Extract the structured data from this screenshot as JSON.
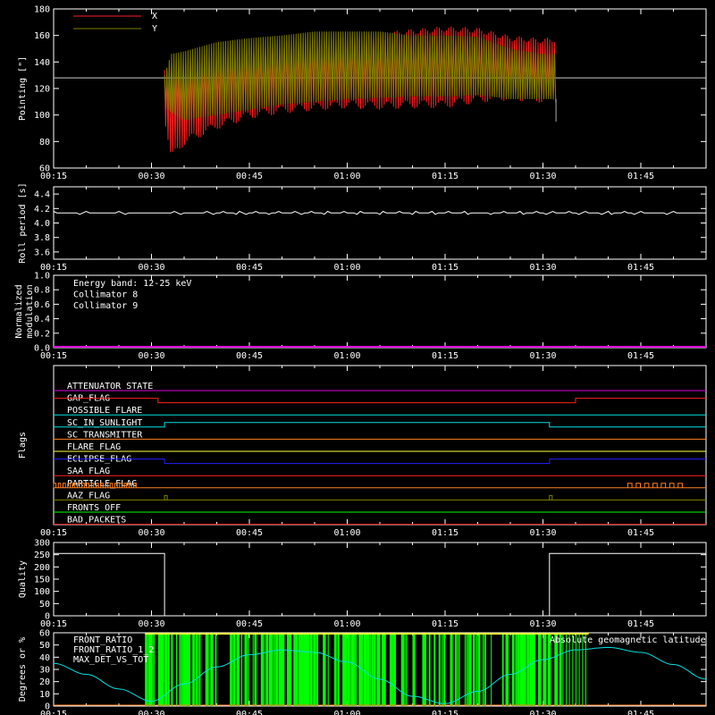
{
  "colors": {
    "background": "#000000",
    "axes": "#ffffff",
    "x_series": "#ff2020",
    "y_series": "#808000",
    "cyan": "#00e0e0",
    "magenta": "#e000e0",
    "green": "#00ff00",
    "yellow": "#ffff40",
    "orange": "#ff8020"
  },
  "time_axis": {
    "start": "00:15",
    "end": "01:55",
    "tick_labels": [
      "00:15",
      "00:30",
      "00:45",
      "01:00",
      "01:15",
      "01:30",
      "01:45"
    ]
  },
  "chart_data": [
    {
      "id": "pointing",
      "type": "line",
      "ylabel": "Pointing [\"]",
      "ylim": [
        60,
        180
      ],
      "yticks": [
        60,
        80,
        100,
        120,
        140,
        160,
        180
      ],
      "reference_line": 128,
      "legend": [
        {
          "name": "X",
          "color": "#ff2020"
        },
        {
          "name": "Y",
          "color": "#808000"
        }
      ],
      "data_start": "00:32",
      "data_end": "01:32",
      "series": [
        {
          "name": "X",
          "time": [
            "00:32",
            "00:33",
            "00:35",
            "00:40",
            "00:45",
            "00:50",
            "00:55",
            "01:00",
            "01:05",
            "01:10",
            "01:15",
            "01:20",
            "01:25",
            "01:30",
            "01:32"
          ],
          "upper": [
            132,
            136,
            140,
            146,
            150,
            153,
            155,
            157,
            160,
            163,
            165,
            164,
            158,
            156,
            157
          ],
          "lower": [
            100,
            68,
            80,
            92,
            100,
            104,
            106,
            108,
            107,
            108,
            108,
            112,
            114,
            112,
            112
          ]
        },
        {
          "name": "Y",
          "time": [
            "00:32",
            "00:33",
            "00:35",
            "00:40",
            "00:45",
            "00:50",
            "00:55",
            "01:00",
            "01:05",
            "01:10",
            "01:15",
            "01:20",
            "01:25",
            "01:30",
            "01:32"
          ],
          "upper": [
            130,
            146,
            148,
            155,
            158,
            160,
            163,
            163,
            163,
            160,
            160,
            159,
            150,
            146,
            146
          ],
          "lower": [
            106,
            102,
            96,
            100,
            104,
            108,
            110,
            112,
            113,
            114,
            114,
            115,
            112,
            112,
            112
          ]
        }
      ]
    },
    {
      "id": "roll",
      "type": "line",
      "ylabel": "Roll period [s]",
      "ylim": [
        3.5,
        4.5
      ],
      "yticks": [
        3.6,
        3.8,
        4.0,
        4.2,
        4.4
      ],
      "series": [
        {
          "name": "",
          "time": [
            "00:15",
            "01:55"
          ],
          "values": [
            4.14,
            4.14
          ]
        }
      ]
    },
    {
      "id": "modulation",
      "type": "line",
      "ylabel": "Normalized modulation",
      "ylim": [
        0,
        1
      ],
      "yticks": [
        0.0,
        0.2,
        0.4,
        0.6,
        0.8,
        1.0
      ],
      "annotations": [
        {
          "text": "Energy band: 12-25 keV",
          "color": "#ffffff"
        },
        {
          "text": "Collimator 8",
          "color": "#00e0e0"
        },
        {
          "text": "Collimator 9",
          "color": "#e000e0"
        }
      ],
      "series": [
        {
          "name": "Collimator 9",
          "time": [
            "00:15",
            "01:55"
          ],
          "values": [
            0.0,
            0.0
          ]
        }
      ]
    },
    {
      "id": "flags",
      "type": "line",
      "ylabel": "Flags",
      "rows": [
        {
          "name": "ATTENUATOR_STATE",
          "color": "#e000e0",
          "level": 0,
          "changes": []
        },
        {
          "name": "GAP_FLAG",
          "color": "#ff2020",
          "level": 1,
          "changes": [
            [
              "00:31",
              0
            ],
            [
              "01:35",
              1
            ]
          ]
        },
        {
          "name": "POSSIBLE_FLARE",
          "color": "#00e0e0",
          "level": 0,
          "changes": []
        },
        {
          "name": "SC_IN_SUNLIGHT",
          "color": "#00e0e0",
          "level": 0,
          "changes": [
            [
              "00:32",
              1
            ],
            [
              "01:31",
              0
            ]
          ]
        },
        {
          "name": "SC_TRANSMITTER",
          "color": "#ff8020",
          "level": 0,
          "changes": []
        },
        {
          "name": "FLARE_FLAG",
          "color": "#ffff40",
          "level": 0,
          "changes": []
        },
        {
          "name": "ECLIPSE_FLAG",
          "color": "#2020ff",
          "level": 1,
          "changes": [
            [
              "00:32",
              0
            ],
            [
              "01:31",
              1
            ]
          ]
        },
        {
          "name": "SAA_FLAG",
          "color": "#ff2020",
          "level": 0,
          "changes": []
        },
        {
          "name": "PARTICLE_FLAG",
          "color": "#ff8020",
          "level": 0,
          "changes": []
        },
        {
          "name": "AAZ_FLAG",
          "color": "#808000",
          "level": 0,
          "changes": []
        },
        {
          "name": "FRONTS_OFF",
          "color": "#00ff00",
          "level": 0,
          "changes": []
        },
        {
          "name": "BAD_PACKETS",
          "color": "#ff2020",
          "level": 0,
          "changes": []
        }
      ]
    },
    {
      "id": "quality",
      "type": "line",
      "ylabel": "Quality",
      "ylim": [
        0,
        300
      ],
      "yticks": [
        0,
        50,
        100,
        150,
        200,
        250,
        300
      ],
      "series": [
        {
          "name": "",
          "time": [
            "00:15",
            "00:32",
            "00:32",
            "01:31",
            "01:31",
            "01:55"
          ],
          "values": [
            255,
            255,
            0,
            0,
            255,
            255
          ]
        }
      ]
    },
    {
      "id": "geomag",
      "type": "line",
      "ylabel": "Degrees or %",
      "ylim": [
        0,
        60
      ],
      "yticks": [
        0,
        10,
        20,
        30,
        40,
        50,
        60
      ],
      "legend": [
        {
          "name": "FRONT_RATIO",
          "color": "#ffff40"
        },
        {
          "name": "FRONT_RATIO_1_2",
          "color": "#00ff00"
        },
        {
          "name": "MAX_DET_VS_TOT",
          "color": "#ff8020"
        },
        {
          "name": "Absolute geomagnetic latitude",
          "color": "#00e0e0"
        }
      ],
      "series": [
        {
          "name": "Absolute geomagnetic latitude",
          "time": [
            "00:15",
            "00:20",
            "00:25",
            "00:30",
            "00:35",
            "00:40",
            "00:45",
            "00:50",
            "00:55",
            "01:00",
            "01:05",
            "01:10",
            "01:15",
            "01:20",
            "01:25",
            "01:30",
            "01:35",
            "01:40",
            "01:45",
            "01:50",
            "01:55"
          ],
          "values": [
            35,
            26,
            14,
            4,
            18,
            32,
            42,
            46,
            44,
            36,
            22,
            8,
            2,
            12,
            26,
            38,
            46,
            48,
            44,
            34,
            22
          ]
        }
      ]
    }
  ]
}
